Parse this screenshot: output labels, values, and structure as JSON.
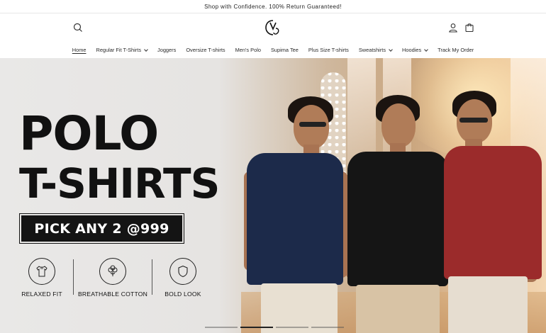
{
  "announcement": "Shop with Confidence. 100% Return Guaranteed!",
  "header": {
    "search_icon": "search-icon",
    "logo_icon": "brand-monogram-logo",
    "account_icon": "user-icon",
    "cart_icon": "bag-icon"
  },
  "nav": {
    "items": [
      {
        "label": "Home",
        "active": true,
        "dropdown": false
      },
      {
        "label": "Regular Fit T-Shirts",
        "active": false,
        "dropdown": true
      },
      {
        "label": "Joggers",
        "active": false,
        "dropdown": false
      },
      {
        "label": "Oversize T-shirts",
        "active": false,
        "dropdown": false
      },
      {
        "label": "Men's Polo",
        "active": false,
        "dropdown": false
      },
      {
        "label": "Supima Tee",
        "active": false,
        "dropdown": false
      },
      {
        "label": "Plus Size T-shirts",
        "active": false,
        "dropdown": false
      },
      {
        "label": "Sweatshirts",
        "active": false,
        "dropdown": true
      },
      {
        "label": "Hoodies",
        "active": false,
        "dropdown": true
      },
      {
        "label": "Track My Order",
        "active": false,
        "dropdown": false
      }
    ]
  },
  "hero": {
    "line1": "POLO",
    "line2": "T-SHIRTS",
    "offer": "PICK ANY 2 @999",
    "features": [
      {
        "label": "RELAXED FIT",
        "icon": "tshirt-icon"
      },
      {
        "label": "BREATHABLE COTTON",
        "icon": "cotton-icon"
      },
      {
        "label": "BOLD LOOK",
        "icon": "shield-icon"
      }
    ],
    "models": [
      {
        "shirt_color": "#1c2a4a",
        "pants_color": "#e8e0d2"
      },
      {
        "shirt_color": "#151515",
        "pants_color": "#d8c3a5"
      },
      {
        "shirt_color": "#9b2b2b",
        "pants_color": "#e6ddd0"
      }
    ]
  },
  "slider": {
    "slide_count": 4,
    "active_index": 1
  },
  "colors": {
    "text": "#121212",
    "offer_bg": "#141414",
    "offer_text": "#ffffff"
  }
}
